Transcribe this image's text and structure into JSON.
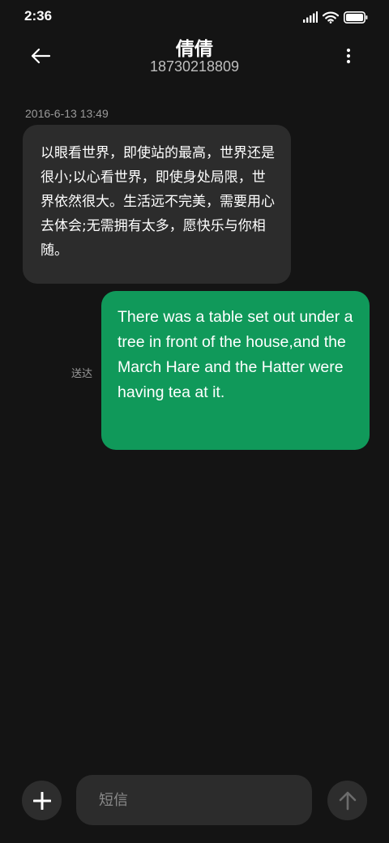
{
  "status_bar": {
    "time": "2:36",
    "icons": [
      "signal-icon",
      "wifi-icon",
      "battery-icon"
    ]
  },
  "header": {
    "contact_name": "倩倩",
    "contact_number": "18730218809",
    "icons": [
      "back-arrow-icon",
      "more-vertical-icon"
    ]
  },
  "messages": [
    {
      "direction": "incoming",
      "timestamp": "2016-6-13 13:49",
      "text": "以眼看世界，即使站的最高，世界还是很小;以心看世界，即使身处局限，世界依然很大。生活远不完美，需要用心去体会;无需拥有太多，愿快乐与你相随。"
    },
    {
      "direction": "outgoing",
      "status": "送达",
      "text": "There was a table set out under a tree in front of the house,and the March Hare and the Hatter were having tea at it."
    }
  ],
  "composer": {
    "placeholder": "短信",
    "value": "",
    "icons": [
      "plus-icon",
      "send-arrow-icon"
    ]
  },
  "colors": {
    "background": "#141414",
    "incoming_bubble": "#2c2c2c",
    "outgoing_bubble": "#10995a",
    "secondary_text": "#9a9a9a"
  }
}
